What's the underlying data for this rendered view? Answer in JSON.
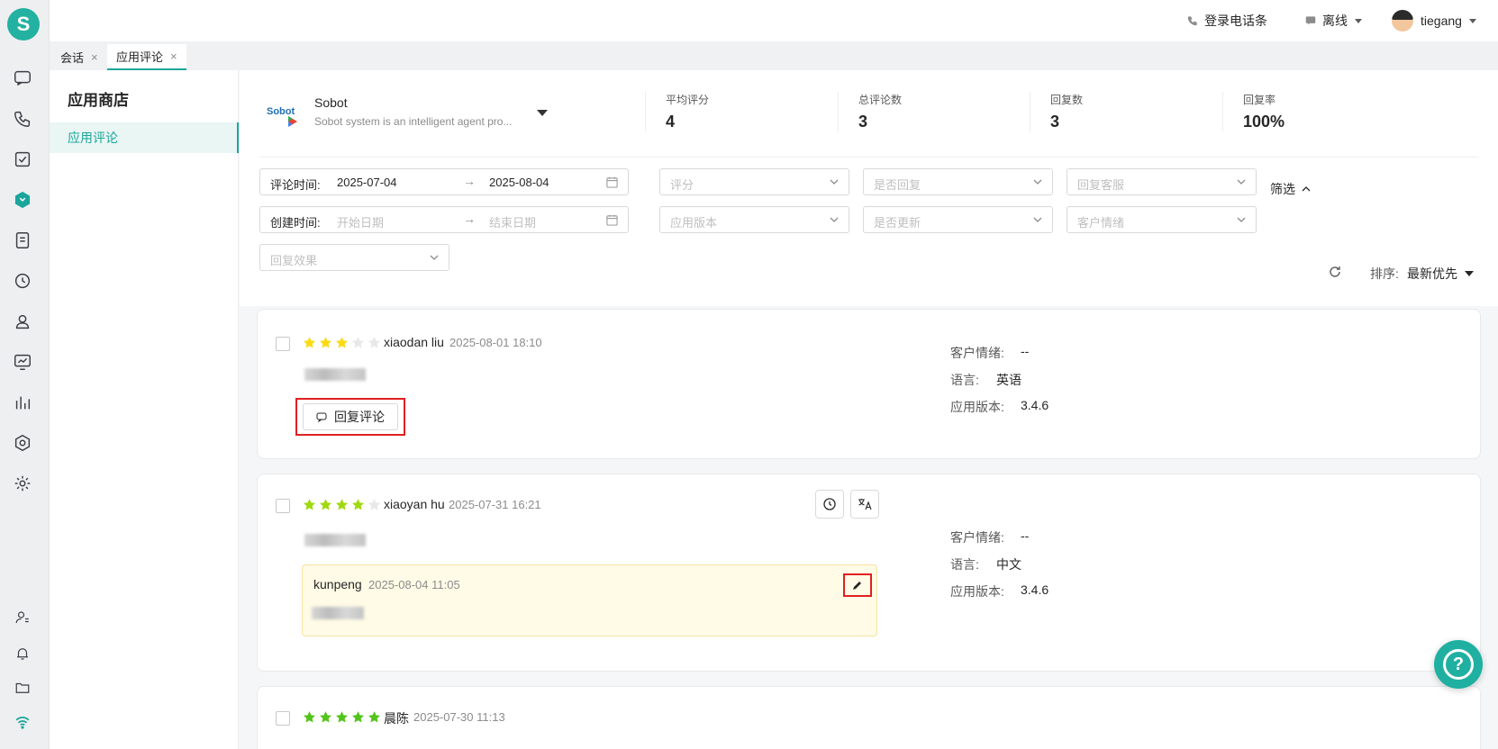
{
  "rail": {
    "logo_letter": "S",
    "icons": [
      "chat-icon",
      "phone-icon",
      "task-icon",
      "app-store-icon",
      "document-icon",
      "history-icon",
      "customer-icon",
      "monitor-icon",
      "statistics-icon",
      "security-icon",
      "settings-icon",
      "user-status-icon",
      "bell-icon",
      "folder-icon",
      "wifi-icon"
    ]
  },
  "header": {
    "phone_bar_label": "登录电话条",
    "status_label": "离线",
    "username": "tiegang"
  },
  "tabs": [
    {
      "label": "会话",
      "close": "×"
    },
    {
      "label": "应用评论",
      "close": "×"
    }
  ],
  "subnav": {
    "title": "应用商店",
    "items": [
      {
        "label": "应用评论"
      }
    ]
  },
  "app": {
    "name": "Sobot",
    "description": "Sobot system is an intelligent agent pro...",
    "icon_text": "Sobot"
  },
  "stats": [
    {
      "label": "平均评分",
      "value": "4"
    },
    {
      "label": "总评论数",
      "value": "3"
    },
    {
      "label": "回复数",
      "value": "3"
    },
    {
      "label": "回复率",
      "value": "100%"
    }
  ],
  "filters": {
    "review_time": {
      "label": "评论时间:",
      "start": "2025-07-04",
      "arrow": "→",
      "end": "2025-08-04"
    },
    "create_time": {
      "label": "创建时间:",
      "start_placeholder": "开始日期",
      "arrow": "→",
      "end_placeholder": "结束日期"
    },
    "rating_placeholder": "评分",
    "replied_placeholder": "是否回复",
    "reply_agent_placeholder": "回复客服",
    "app_version_placeholder": "应用版本",
    "updated_placeholder": "是否更新",
    "customer_emotion_placeholder": "客户情绪",
    "reply_effect_placeholder": "回复效果",
    "toggle_label": "筛选",
    "sort_label": "排序:",
    "sort_value": "最新优先"
  },
  "reviews": [
    {
      "rating": 3,
      "star_color": "#fadb14",
      "author": "xiaodan liu",
      "time": "2025-08-01 18:10",
      "reply_button_label": "回复评论",
      "emotion_label": "客户情绪:",
      "emotion_value": "--",
      "language_label": "语言:",
      "language_value": "英语",
      "version_label": "应用版本:",
      "version_value": "3.4.6"
    },
    {
      "rating": 4,
      "star_color": "#a0d911",
      "author": "xiaoyan hu",
      "time": "2025-07-31 16:21",
      "reply": {
        "author": "kunpeng",
        "time": "2025-08-04 11:05"
      },
      "emotion_label": "客户情绪:",
      "emotion_value": "--",
      "language_label": "语言:",
      "language_value": "中文",
      "version_label": "应用版本:",
      "version_value": "3.4.6"
    },
    {
      "rating": 5,
      "star_color": "#52c41a",
      "author": "晨陈",
      "time": "2025-07-30 11:13"
    }
  ],
  "fab": {
    "symbol": "?"
  }
}
